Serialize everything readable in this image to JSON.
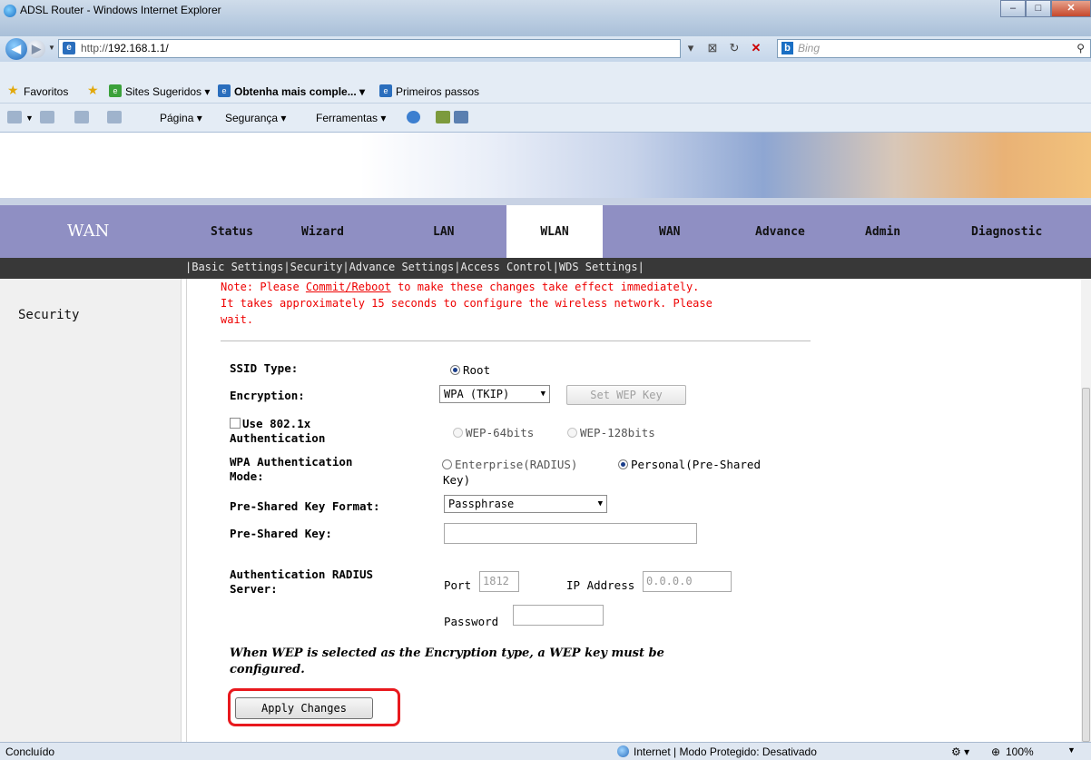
{
  "browser": {
    "window_title": "ADSL Router - Windows Internet Explorer",
    "address_prefix": "http://",
    "address_host": "192.168.1.1/",
    "search_placeholder": "Bing",
    "favorites_label": "Favoritos",
    "favorites_items": [
      "Sites Sugeridos ▾",
      "Obtenha mais comple... ▾",
      "Primeiros passos"
    ],
    "command_items": [
      "Página ▾",
      "Segurança ▾",
      "Ferramentas ▾"
    ],
    "status_left": "Concluído",
    "status_zone": "Internet | Modo Protegido: Desativado",
    "zoom": "100%"
  },
  "router": {
    "brand": "WAN",
    "tabs": [
      "Status",
      "Wizard",
      "LAN",
      "WLAN",
      "WAN",
      "Advance",
      "Admin",
      "Diagnostic"
    ],
    "active_tab": "WLAN",
    "subnav": [
      "Basic Settings",
      "Security",
      "Advance Settings",
      "Access Control",
      "WDS Settings"
    ],
    "sidebar_item": "Security"
  },
  "form": {
    "note_prefix": "Note: Please ",
    "note_link": "Commit/Reboot",
    "note_line1_rest": " to make these changes take effect immediately.",
    "note_line2": "It takes approximately 15 seconds to configure the wireless network. Please",
    "note_line3": "wait.",
    "ssid_type_label": "SSID Type:",
    "ssid_type_value": "Root",
    "encryption_label": "Encryption:",
    "encryption_value": "WPA (TKIP)",
    "set_wep_key_label": "Set WEP Key",
    "use8021x_line1": "Use 802.1x",
    "use8021x_line2": "Authentication",
    "wep64_label": "WEP-64bits",
    "wep128_label": "WEP-128bits",
    "wpa_auth_line1": "WPA Authentication",
    "wpa_auth_line2": "Mode:",
    "enterprise_label": "Enterprise(RADIUS)",
    "personal_label_line1": "Personal(Pre-Shared",
    "personal_label_line2": "Key)",
    "psk_format_label": "Pre-Shared Key Format:",
    "psk_format_value": "Passphrase",
    "psk_label": "Pre-Shared Key:",
    "psk_value": "",
    "radius_line1": "Authentication RADIUS",
    "radius_line2": "Server:",
    "port_label": "Port",
    "port_value": "1812",
    "ip_label": "IP Address",
    "ip_value": "0.0.0.0",
    "password_label": "Password",
    "password_value": "",
    "wep_note_line1": "When WEP is selected as the Encryption type, a WEP key must be",
    "wep_note_line2": "configured.",
    "apply_label": "Apply Changes"
  }
}
